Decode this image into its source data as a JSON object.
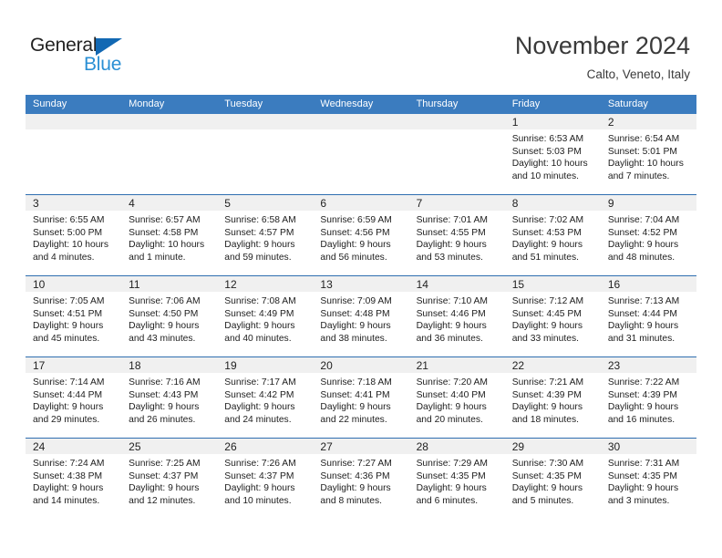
{
  "brand": {
    "name_part1": "General",
    "name_part2": "Blue"
  },
  "header": {
    "title": "November 2024",
    "subtitle": "Calto, Veneto, Italy"
  },
  "colors": {
    "header_band": "#3b7cbf",
    "week_divider": "#2f6eb0",
    "day_number_strip": "#f0f0f0",
    "brand_blue": "#2a8fd4",
    "brand_triangle": "#1268b3"
  },
  "weekdays": [
    "Sunday",
    "Monday",
    "Tuesday",
    "Wednesday",
    "Thursday",
    "Friday",
    "Saturday"
  ],
  "weeks": [
    [
      {
        "day": "",
        "lines": []
      },
      {
        "day": "",
        "lines": []
      },
      {
        "day": "",
        "lines": []
      },
      {
        "day": "",
        "lines": []
      },
      {
        "day": "",
        "lines": []
      },
      {
        "day": "1",
        "lines": [
          "Sunrise: 6:53 AM",
          "Sunset: 5:03 PM",
          "Daylight: 10 hours",
          "and 10 minutes."
        ]
      },
      {
        "day": "2",
        "lines": [
          "Sunrise: 6:54 AM",
          "Sunset: 5:01 PM",
          "Daylight: 10 hours",
          "and 7 minutes."
        ]
      }
    ],
    [
      {
        "day": "3",
        "lines": [
          "Sunrise: 6:55 AM",
          "Sunset: 5:00 PM",
          "Daylight: 10 hours",
          "and 4 minutes."
        ]
      },
      {
        "day": "4",
        "lines": [
          "Sunrise: 6:57 AM",
          "Sunset: 4:58 PM",
          "Daylight: 10 hours",
          "and 1 minute."
        ]
      },
      {
        "day": "5",
        "lines": [
          "Sunrise: 6:58 AM",
          "Sunset: 4:57 PM",
          "Daylight: 9 hours",
          "and 59 minutes."
        ]
      },
      {
        "day": "6",
        "lines": [
          "Sunrise: 6:59 AM",
          "Sunset: 4:56 PM",
          "Daylight: 9 hours",
          "and 56 minutes."
        ]
      },
      {
        "day": "7",
        "lines": [
          "Sunrise: 7:01 AM",
          "Sunset: 4:55 PM",
          "Daylight: 9 hours",
          "and 53 minutes."
        ]
      },
      {
        "day": "8",
        "lines": [
          "Sunrise: 7:02 AM",
          "Sunset: 4:53 PM",
          "Daylight: 9 hours",
          "and 51 minutes."
        ]
      },
      {
        "day": "9",
        "lines": [
          "Sunrise: 7:04 AM",
          "Sunset: 4:52 PM",
          "Daylight: 9 hours",
          "and 48 minutes."
        ]
      }
    ],
    [
      {
        "day": "10",
        "lines": [
          "Sunrise: 7:05 AM",
          "Sunset: 4:51 PM",
          "Daylight: 9 hours",
          "and 45 minutes."
        ]
      },
      {
        "day": "11",
        "lines": [
          "Sunrise: 7:06 AM",
          "Sunset: 4:50 PM",
          "Daylight: 9 hours",
          "and 43 minutes."
        ]
      },
      {
        "day": "12",
        "lines": [
          "Sunrise: 7:08 AM",
          "Sunset: 4:49 PM",
          "Daylight: 9 hours",
          "and 40 minutes."
        ]
      },
      {
        "day": "13",
        "lines": [
          "Sunrise: 7:09 AM",
          "Sunset: 4:48 PM",
          "Daylight: 9 hours",
          "and 38 minutes."
        ]
      },
      {
        "day": "14",
        "lines": [
          "Sunrise: 7:10 AM",
          "Sunset: 4:46 PM",
          "Daylight: 9 hours",
          "and 36 minutes."
        ]
      },
      {
        "day": "15",
        "lines": [
          "Sunrise: 7:12 AM",
          "Sunset: 4:45 PM",
          "Daylight: 9 hours",
          "and 33 minutes."
        ]
      },
      {
        "day": "16",
        "lines": [
          "Sunrise: 7:13 AM",
          "Sunset: 4:44 PM",
          "Daylight: 9 hours",
          "and 31 minutes."
        ]
      }
    ],
    [
      {
        "day": "17",
        "lines": [
          "Sunrise: 7:14 AM",
          "Sunset: 4:44 PM",
          "Daylight: 9 hours",
          "and 29 minutes."
        ]
      },
      {
        "day": "18",
        "lines": [
          "Sunrise: 7:16 AM",
          "Sunset: 4:43 PM",
          "Daylight: 9 hours",
          "and 26 minutes."
        ]
      },
      {
        "day": "19",
        "lines": [
          "Sunrise: 7:17 AM",
          "Sunset: 4:42 PM",
          "Daylight: 9 hours",
          "and 24 minutes."
        ]
      },
      {
        "day": "20",
        "lines": [
          "Sunrise: 7:18 AM",
          "Sunset: 4:41 PM",
          "Daylight: 9 hours",
          "and 22 minutes."
        ]
      },
      {
        "day": "21",
        "lines": [
          "Sunrise: 7:20 AM",
          "Sunset: 4:40 PM",
          "Daylight: 9 hours",
          "and 20 minutes."
        ]
      },
      {
        "day": "22",
        "lines": [
          "Sunrise: 7:21 AM",
          "Sunset: 4:39 PM",
          "Daylight: 9 hours",
          "and 18 minutes."
        ]
      },
      {
        "day": "23",
        "lines": [
          "Sunrise: 7:22 AM",
          "Sunset: 4:39 PM",
          "Daylight: 9 hours",
          "and 16 minutes."
        ]
      }
    ],
    [
      {
        "day": "24",
        "lines": [
          "Sunrise: 7:24 AM",
          "Sunset: 4:38 PM",
          "Daylight: 9 hours",
          "and 14 minutes."
        ]
      },
      {
        "day": "25",
        "lines": [
          "Sunrise: 7:25 AM",
          "Sunset: 4:37 PM",
          "Daylight: 9 hours",
          "and 12 minutes."
        ]
      },
      {
        "day": "26",
        "lines": [
          "Sunrise: 7:26 AM",
          "Sunset: 4:37 PM",
          "Daylight: 9 hours",
          "and 10 minutes."
        ]
      },
      {
        "day": "27",
        "lines": [
          "Sunrise: 7:27 AM",
          "Sunset: 4:36 PM",
          "Daylight: 9 hours",
          "and 8 minutes."
        ]
      },
      {
        "day": "28",
        "lines": [
          "Sunrise: 7:29 AM",
          "Sunset: 4:35 PM",
          "Daylight: 9 hours",
          "and 6 minutes."
        ]
      },
      {
        "day": "29",
        "lines": [
          "Sunrise: 7:30 AM",
          "Sunset: 4:35 PM",
          "Daylight: 9 hours",
          "and 5 minutes."
        ]
      },
      {
        "day": "30",
        "lines": [
          "Sunrise: 7:31 AM",
          "Sunset: 4:35 PM",
          "Daylight: 9 hours",
          "and 3 minutes."
        ]
      }
    ]
  ]
}
